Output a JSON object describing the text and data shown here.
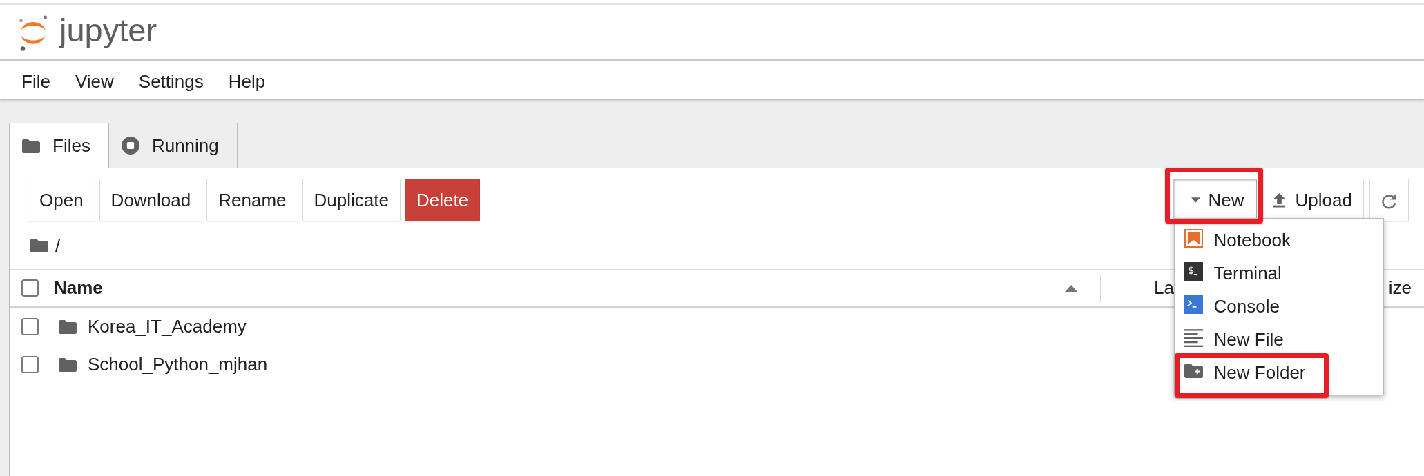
{
  "header": {
    "logo_text": "jupyter"
  },
  "menu_bar": {
    "items": [
      "File",
      "View",
      "Settings",
      "Help"
    ]
  },
  "sidebar_tabs": [
    {
      "label": "Files",
      "kind": "files",
      "selected": true
    },
    {
      "label": "Running",
      "kind": "running",
      "selected": false
    }
  ],
  "toolbar": {
    "actions": [
      {
        "label": "Open",
        "kind": "plain"
      },
      {
        "label": "Download",
        "kind": "plain"
      },
      {
        "label": "Rename",
        "kind": "plain"
      },
      {
        "label": "Duplicate",
        "kind": "plain"
      },
      {
        "label": "Delete",
        "kind": "danger"
      }
    ],
    "file_buttons": [
      {
        "label": "New",
        "kind": "dropdown",
        "expanded": true,
        "highlighted": true,
        "menu": {
          "items": [
            {
              "label": "Notebook",
              "kind": "notebook",
              "highlighted": false
            },
            {
              "label": "Terminal",
              "kind": "terminal",
              "highlighted": false
            },
            {
              "label": "Console",
              "kind": "console",
              "highlighted": false
            },
            {
              "label": "New File",
              "kind": "file",
              "highlighted": false
            },
            {
              "label": "New Folder",
              "kind": "folder",
              "highlighted": true
            }
          ]
        }
      },
      {
        "label": "Upload",
        "kind": "upload",
        "expanded": false,
        "highlighted": false
      },
      {
        "kind": "refresh",
        "expanded": false,
        "highlighted": false
      }
    ]
  },
  "breadcrumb": {
    "path": "/"
  },
  "file_list": {
    "select_all": {
      "checked": false
    },
    "columns": [
      {
        "label": "Name",
        "sorted": true
      },
      {
        "label": "La",
        "sorted": false
      },
      {
        "label": "ize",
        "sorted": false
      }
    ],
    "rows": [
      {
        "name": "Korea_IT_Academy",
        "checked": false
      },
      {
        "name": "School_Python_mjhan",
        "checked": false
      }
    ]
  }
}
